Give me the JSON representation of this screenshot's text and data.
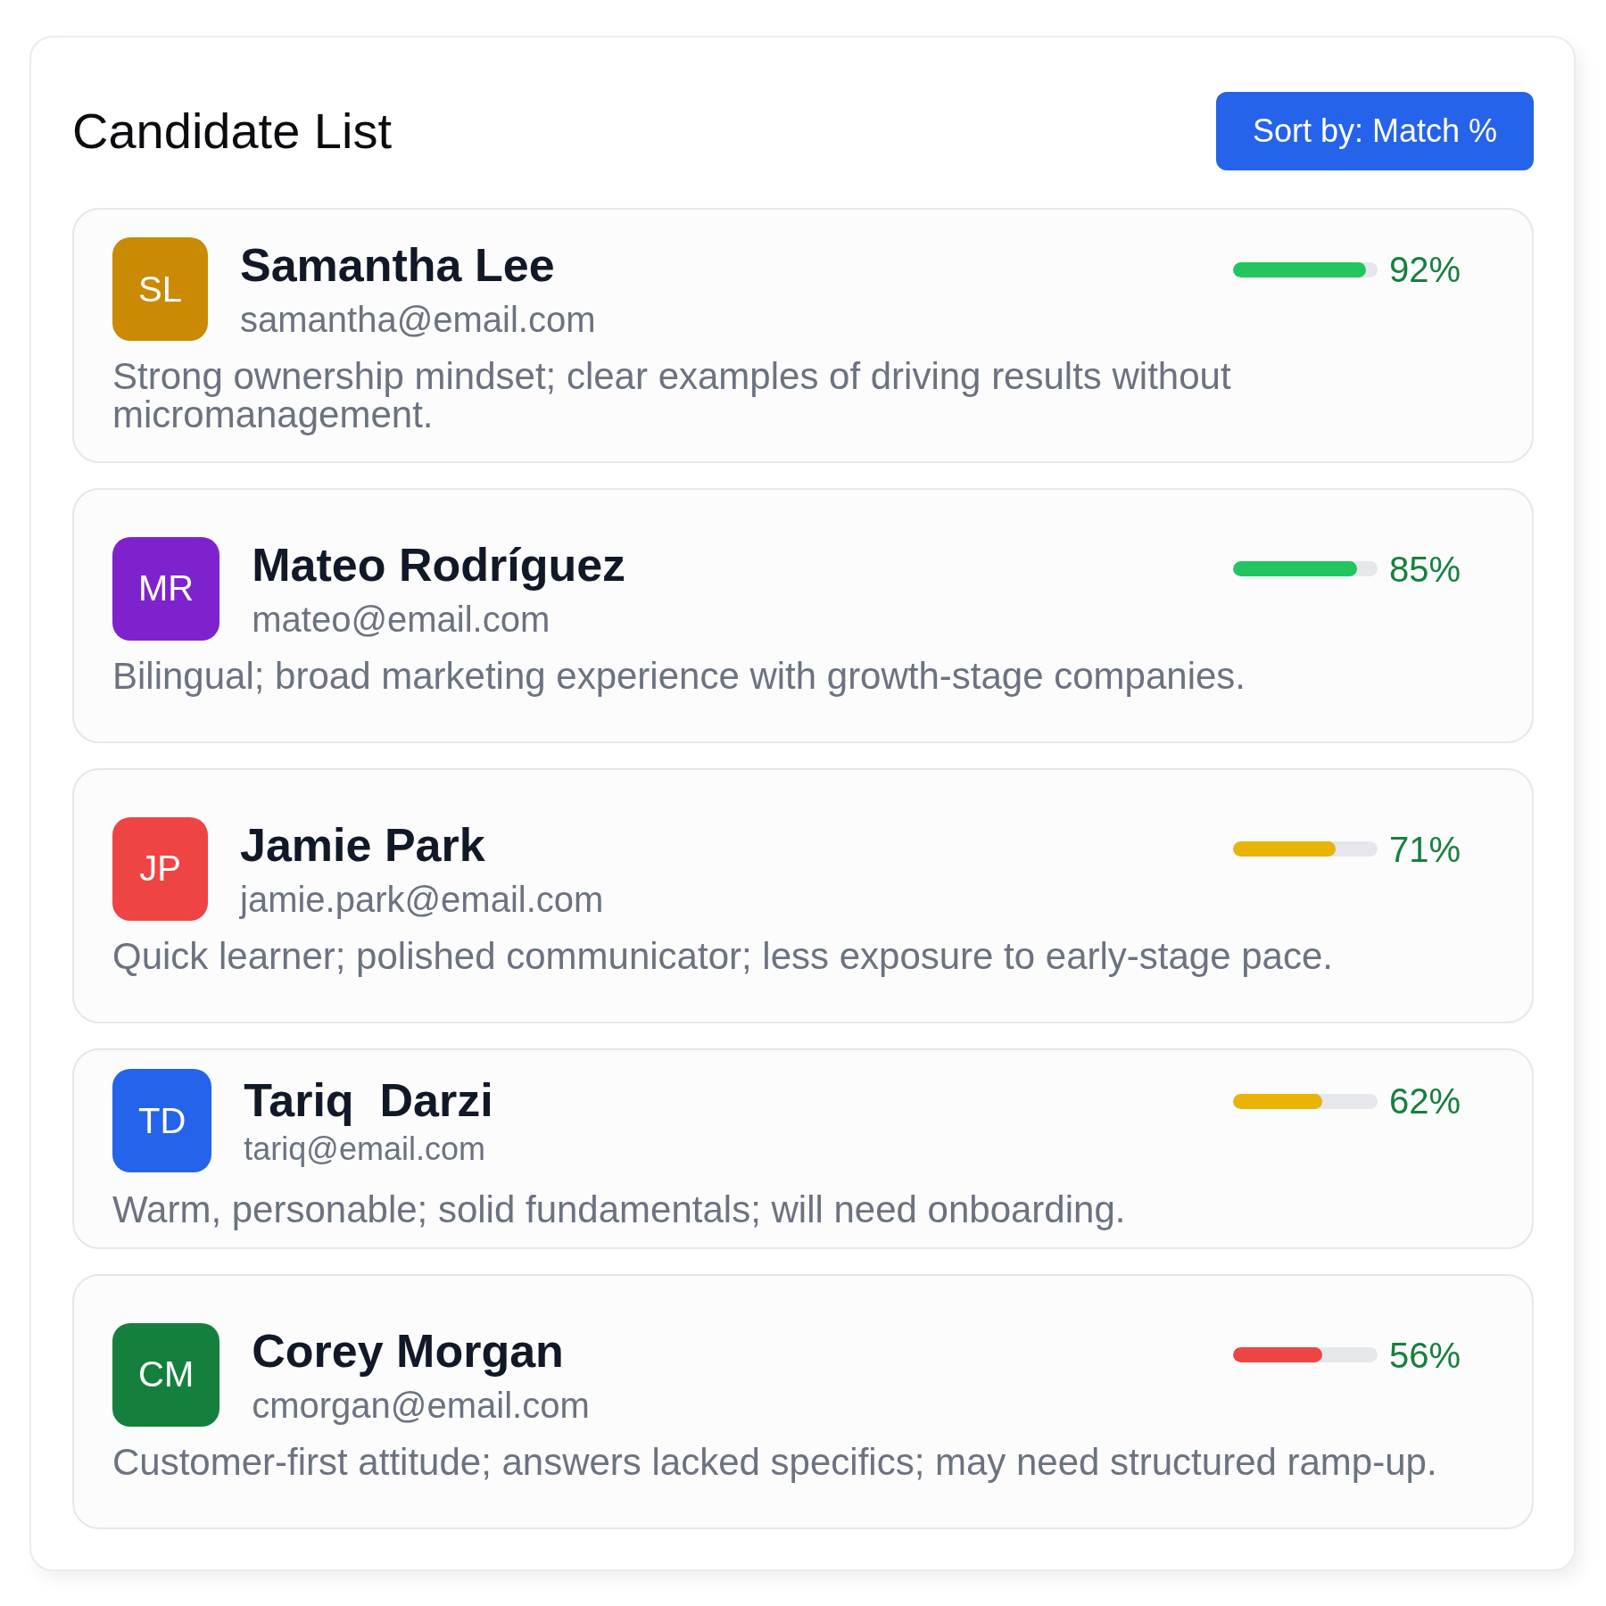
{
  "panel": {
    "title": "Candidate List",
    "sort_button": {
      "label": "Sort by: Match %"
    }
  },
  "candidates": [
    {
      "kind": "standard",
      "initials": "SL",
      "color": "#ca8a04",
      "name": "Samantha Lee",
      "email": "samantha@email.com",
      "match": {
        "level": 0.92,
        "color": "#22c55e",
        "reading": "92%"
      },
      "note": "Strong ownership mindset; clear examples of driving results without micromanagement."
    },
    {
      "kind": "standard",
      "initials": "MR",
      "color": "#7e22ce",
      "name": "Mateo Rodríguez",
      "email": "mateo@email.com",
      "match": {
        "level": 0.86,
        "color": "#22c55e",
        "reading": "85%"
      },
      "note": "Bilingual; broad marketing experience with growth-stage companies."
    },
    {
      "kind": "standard",
      "initials": "JP",
      "color": "#ef4444",
      "name": "Jamie Park",
      "email": "jamie.park@email.com",
      "match": {
        "level": 0.71,
        "color": "#eab308",
        "reading": "71%"
      },
      "note": "Quick learner; polished communicator; less exposure to early-stage pace."
    },
    {
      "kind": "compact",
      "initials": "TD",
      "color": "#2563eb",
      "name": "Tariq  Darzi",
      "email": "tariq@email.com",
      "match": {
        "level": 0.62,
        "color": "#eab308",
        "reading": "62%"
      },
      "note": "Warm, personable; solid fundamentals; will need onboarding."
    },
    {
      "kind": "standard",
      "initials": "CM",
      "color": "#15803d",
      "name": "Corey Morgan",
      "email": "cmorgan@email.com",
      "match": {
        "level": 0.62,
        "color": "#ef4444",
        "reading": "56%"
      },
      "note": "Customer-first attitude; answers lacked specifics; may need structured ramp-up."
    }
  ]
}
